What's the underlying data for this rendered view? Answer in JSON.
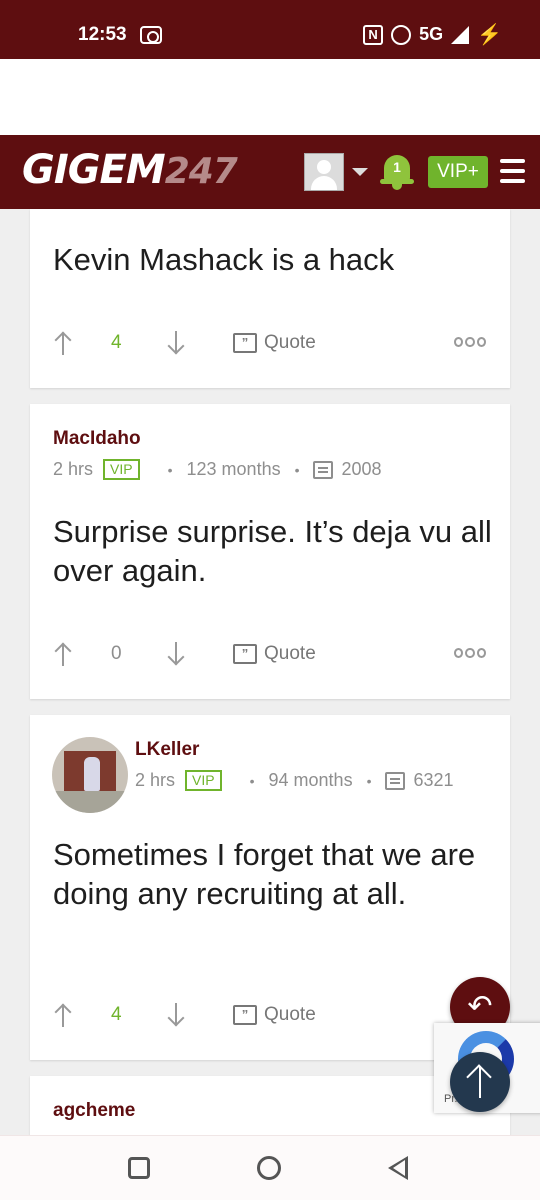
{
  "status_bar": {
    "time": "12:53",
    "network": "5G"
  },
  "header": {
    "logo_text": "GIGEM",
    "logo_number": "247",
    "notification_count": "1",
    "vip_label": "VIP+"
  },
  "posts": [
    {
      "text": "Kevin Mashack is a hack",
      "votes": "4",
      "quote_label": "Quote"
    },
    {
      "username": "MacIdaho",
      "time": "2 hrs",
      "badge": "VIP",
      "tenure": "123 months",
      "post_count": "2008",
      "text": "Surprise surprise. It’s deja vu all over again.",
      "votes": "0",
      "quote_label": "Quote"
    },
    {
      "username": "LKeller",
      "time": "2 hrs",
      "badge": "VIP",
      "tenure": "94 months",
      "post_count": "6321",
      "text": "Sometimes I forget that we are doing any recruiting at all.",
      "votes": "4",
      "quote_label": "Quote"
    },
    {
      "username": "agcheme"
    }
  ],
  "recaptcha": {
    "text": "Pr... erms"
  },
  "colors": {
    "brand": "#5e0e10",
    "accent": "#70b42c"
  }
}
